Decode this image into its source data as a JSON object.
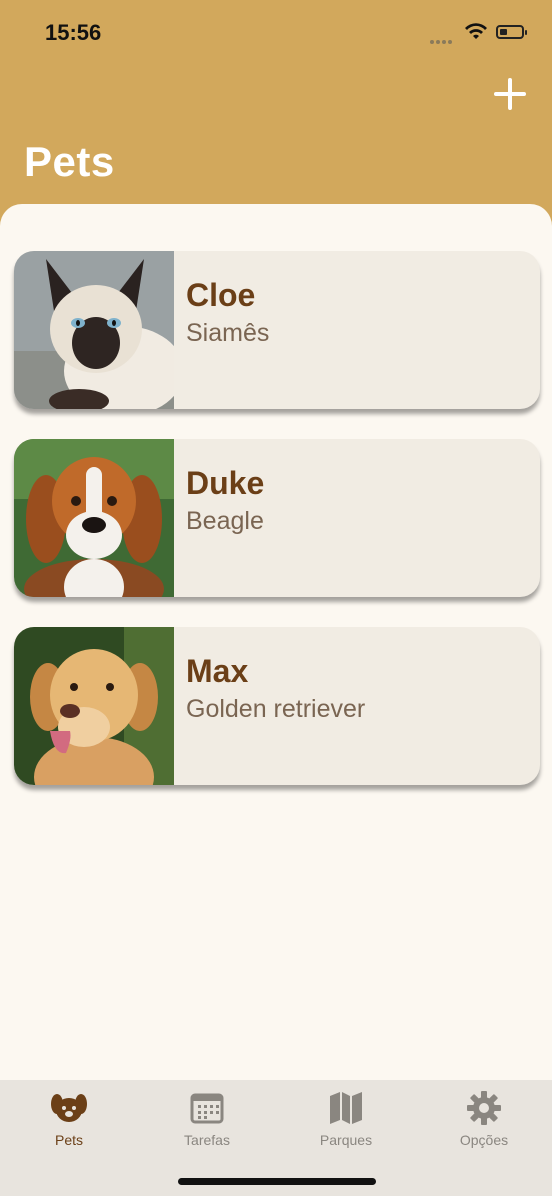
{
  "status_bar": {
    "time": "15:56"
  },
  "header": {
    "title": "Pets"
  },
  "pets": [
    {
      "name": "Cloe",
      "breed": "Siamês",
      "photo": "siamese-cat-photo"
    },
    {
      "name": "Duke",
      "breed": "Beagle",
      "photo": "beagle-photo"
    },
    {
      "name": "Max",
      "breed": "Golden retriever",
      "photo": "golden-retriever-photo"
    }
  ],
  "tabbar": {
    "tabs": [
      {
        "label": "Pets",
        "icon": "dog-icon",
        "active": true
      },
      {
        "label": "Tarefas",
        "icon": "calendar-icon",
        "active": false
      },
      {
        "label": "Parques",
        "icon": "map-icon",
        "active": false
      },
      {
        "label": "Opções",
        "icon": "gear-icon",
        "active": false
      }
    ]
  },
  "colors": {
    "header": "#d2a85c",
    "background": "#fcf8f1",
    "card": "#f1ece3",
    "name": "#6b3f17",
    "breed": "#7a6552",
    "tab_active": "#6b3f17",
    "tab_inactive": "#8a8680"
  }
}
